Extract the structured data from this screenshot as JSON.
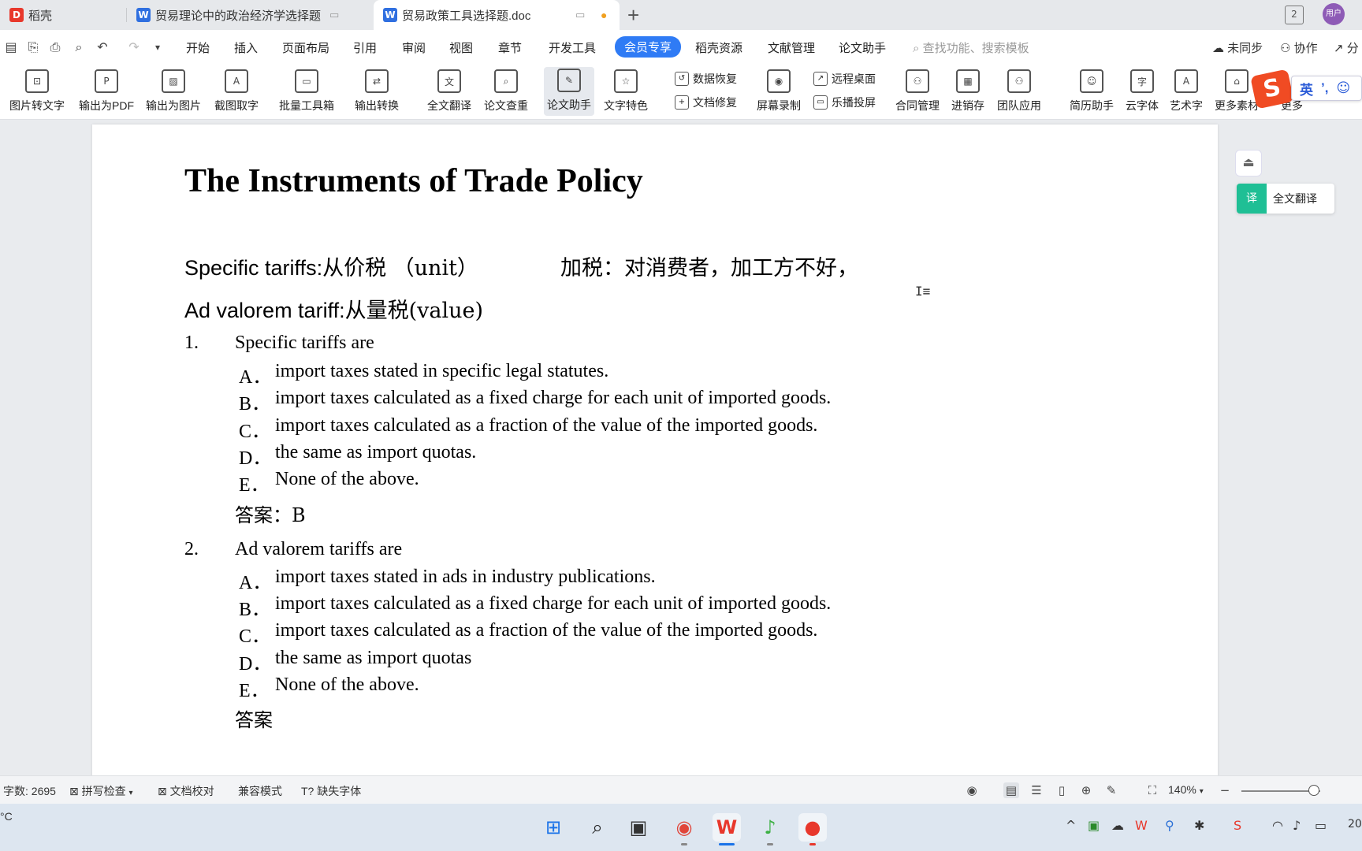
{
  "tabs": [
    {
      "label": "稻壳",
      "icon": "docer-icon",
      "color": "#e8382c"
    },
    {
      "label": "贸易理论中的政治经济学选择题",
      "icon": "wps-writer-icon",
      "color": "#2f6fe0"
    },
    {
      "label": "贸易政策工具选择题.doc",
      "icon": "wps-writer-icon",
      "color": "#2f6fe0",
      "active": true
    }
  ],
  "menu": {
    "items": [
      "开始",
      "插入",
      "页面布局",
      "引用",
      "审阅",
      "视图",
      "章节",
      "开发工具",
      "会员专享",
      "稻壳资源",
      "文献管理",
      "论文助手"
    ],
    "search_placeholder": "查找功能、搜索模板",
    "sync": "未同步",
    "collab": "协作",
    "share": "分"
  },
  "ribbon": {
    "buttons": [
      "图片转文字",
      "输出为PDF",
      "输出为图片",
      "截图取字",
      "批量工具箱",
      "输出转换",
      "全文翻译",
      "论文查重",
      "论文助手",
      "文字特色"
    ],
    "small": [
      "数据恢复",
      "文档修复",
      "远程桌面",
      "乐播投屏"
    ],
    "buttons2": [
      "屏幕录制",
      "合同管理",
      "进销存",
      "团队应用",
      "简历助手",
      "云字体",
      "艺术字",
      "更多素材",
      "更多"
    ],
    "ime": "英"
  },
  "document": {
    "title": "The Instruments of Trade Policy",
    "line1_en": "Specific tariffs:",
    "line1_cn": "从价税 （unit）",
    "line1_note": "加税：对消费者，加工方不好，",
    "line2_en": "Ad valorem tariff:",
    "line2_cn": "从量税(value)",
    "questions": [
      {
        "num": "1.",
        "text": "Specific tariffs are",
        "options": [
          {
            "letter": "A．",
            "text": "import taxes stated in specific legal statutes."
          },
          {
            "letter": "B．",
            "text": "import taxes calculated as a fixed charge for each unit of imported goods."
          },
          {
            "letter": "C．",
            "text": "import taxes calculated as a fraction of the value of the imported goods."
          },
          {
            "letter": "D．",
            "text": "the same as import quotas."
          },
          {
            "letter": "E．",
            "text": "None of the above."
          }
        ],
        "answer": "答案：B"
      },
      {
        "num": "2.",
        "text": "Ad valorem tariffs are",
        "options": [
          {
            "letter": "A．",
            "text": "import taxes stated in ads in industry publications."
          },
          {
            "letter": "B．",
            "text": "import taxes calculated as a fixed charge for each unit of imported goods."
          },
          {
            "letter": "C．",
            "text": "import taxes calculated as a fraction of the value of the imported goods."
          },
          {
            "letter": "D．",
            "text": "the same as import quotas"
          },
          {
            "letter": "E．",
            "text": "None of the above."
          }
        ],
        "answer": "答案"
      }
    ]
  },
  "side_panel": {
    "translate": "全文翻译"
  },
  "status": {
    "word_count": "字数: 2695",
    "spell_check": "拼写检查",
    "doc_check": "文档校对",
    "compat": "兼容模式",
    "missing_font": "缺失字体",
    "zoom": "140%"
  },
  "taskbar": {
    "temp": "°C",
    "clock": "20"
  }
}
